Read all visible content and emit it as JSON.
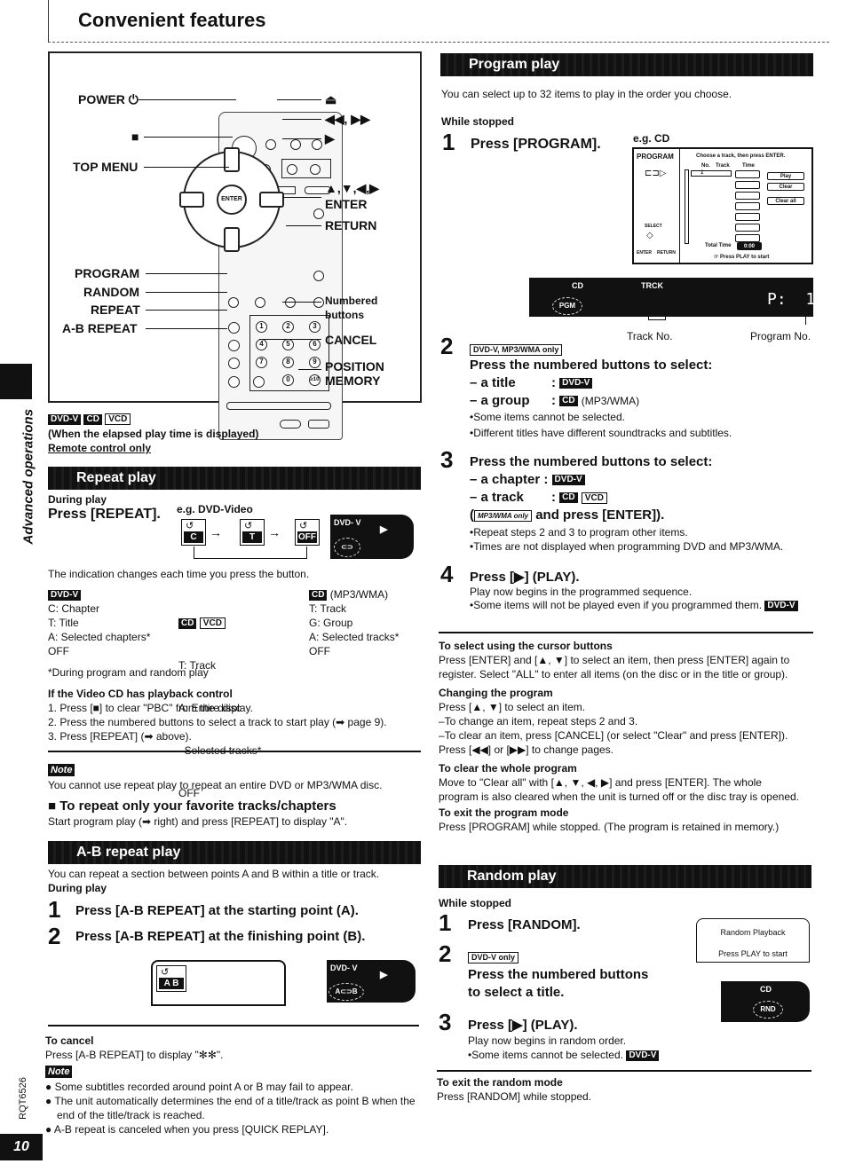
{
  "page": {
    "title": "Convenient features",
    "side_label": "Advanced operations",
    "page_number": "10",
    "doc_code": "RQT6526"
  },
  "remote": {
    "labels_left": [
      "POWER ⏻",
      "■",
      "TOP MENU",
      "PROGRAM",
      "RANDOM",
      "REPEAT",
      "A-B REPEAT"
    ],
    "labels_right": [
      "⏏",
      "◀◀, ▶▶",
      "▶",
      "▲,▼,◀,▶",
      "ENTER",
      "RETURN",
      "Numbered",
      "buttons",
      "CANCEL",
      "POSITION",
      "MEMORY"
    ],
    "numbers": [
      "1",
      "2",
      "3",
      "4",
      "5",
      "6",
      "7",
      "8",
      "9",
      "0",
      "≥10"
    ],
    "enter_label": "ENTER",
    "badges": [
      "DVD-V",
      "CD",
      "VCD"
    ],
    "condition": "(When the elapsed play time is displayed)",
    "remote_only": "Remote control only"
  },
  "repeat": {
    "heading": "Repeat play",
    "during": "During play",
    "instruction": "Press [REPEAT].",
    "example": "e.g. DVD-Video",
    "cycle": [
      "C",
      "T",
      "OFF"
    ],
    "lcd_label": "DVD- V",
    "indication": "The indication changes each time you press the button.",
    "columns": [
      {
        "badges": [
          "DVD-V"
        ],
        "suffix": "",
        "items": [
          "C: Chapter",
          "T: Title",
          "A: Selected chapters*",
          "OFF"
        ]
      },
      {
        "badges": [
          "CD",
          "VCD"
        ],
        "suffix": "",
        "items": [
          "T: Track",
          "A: Entire disc",
          "  Selected tracks*",
          "OFF"
        ]
      },
      {
        "badges": [
          "CD"
        ],
        "suffix": "(MP3/WMA)",
        "items": [
          "T: Track",
          "G: Group",
          "A: Selected tracks*",
          "OFF"
        ]
      }
    ],
    "footnote": "*During program and random play",
    "vcd_heading": "If the Video CD has playback control",
    "vcd_steps": [
      "1.  Press [■] to clear \"PBC\" from the display.",
      "2.  Press the numbered buttons to select a track to start play (➡ page 9).",
      "3.  Press [REPEAT] (➡ above)."
    ],
    "note_label": "Note",
    "note_text": "You cannot use repeat play to repeat an entire DVD or MP3/WMA disc.",
    "fav_heading": "■ To repeat only your favorite tracks/chapters",
    "fav_text": "Start program play (➡ right) and press [REPEAT] to display \"A\"."
  },
  "ab_repeat": {
    "heading": "A-B repeat play",
    "intro": "You can repeat a section between points A and B within a title or track.",
    "during": "During play",
    "steps": [
      {
        "num": "1",
        "text": "Press [A-B REPEAT] at the starting point (A)."
      },
      {
        "num": "2",
        "text": "Press [A-B REPEAT] at the finishing point (B)."
      }
    ],
    "osd_label": "A B",
    "lcd_label": "DVD- V",
    "lcd_indicator": "A⊂⊃B",
    "cancel_heading": "To cancel",
    "cancel_text": "Press [A-B REPEAT] to display \"✻✻\".",
    "note_label": "Note",
    "notes": [
      "Some subtitles recorded around point A or B may fail to appear.",
      "The unit automatically determines the end of a title/track as point B when the end of the title/track is reached.",
      "A-B repeat is canceled when you press [QUICK REPLAY]."
    ]
  },
  "program": {
    "heading": "Program play",
    "intro": "You can select up to 32 items to play in the order you choose.",
    "while_stopped": "While stopped",
    "step1": {
      "num": "1",
      "text": "Press [PROGRAM]."
    },
    "example": "e.g. CD",
    "osd": {
      "title": "PROGRAM",
      "instruction": "Choose a track, then press ENTER.",
      "col_no": "No.",
      "col_track": "Track",
      "col_time": "Time",
      "row_no": "1",
      "buttons": [
        "Play",
        "Clear",
        "Clear all"
      ],
      "select": "SELECT",
      "enter": "ENTER",
      "return": "RETURN",
      "total_time": "Total Time",
      "total_value": "0:00",
      "hint": "☞ Press PLAY to start"
    },
    "lcd": {
      "disc": "CD",
      "track": "TRCK",
      "pgm": "PGM",
      "display": "P:  1"
    },
    "track_no": "Track No.",
    "program_no": "Program No.",
    "step2": {
      "num": "2",
      "badge": "DVD-V, MP3/WMA only",
      "text": "Press the numbered buttons to select:",
      "options": [
        {
          "label": "– a title",
          "badge": "DVD-V",
          "suffix": ""
        },
        {
          "label": "– a group",
          "badge": "CD",
          "suffix": "(MP3/WMA)"
        }
      ],
      "bullets": [
        "•Some items cannot be selected.",
        "•Different titles have different soundtracks and subtitles."
      ]
    },
    "step3": {
      "num": "3",
      "text": "Press the numbered buttons to select:",
      "chapter": "– a chapter :",
      "chapter_badge": "DVD-V",
      "track": "– a track",
      "track_badges": [
        "CD",
        "VCD"
      ],
      "mp3_badge": "MP3/WMA only",
      "mp3_text": "and press [ENTER]).",
      "bullets": [
        "•Repeat steps 2 and 3 to program other items.",
        "•Times are not displayed when programming DVD and MP3/WMA."
      ]
    },
    "step4": {
      "num": "4",
      "text": "Press [▶] (PLAY).",
      "desc": "Play now begins in the programmed sequence.",
      "bullet": "•Some items will not be played even if you programmed them.",
      "badge": "DVD-V"
    },
    "tips": [
      {
        "heading": "To select using the cursor buttons",
        "lines": [
          "Press [ENTER] and [▲, ▼] to select an item, then press [ENTER] again to",
          "register. Select \"ALL\" to enter all items (on the disc or in the title or group)."
        ]
      },
      {
        "heading": "Changing the program",
        "lines": [
          "Press [▲, ▼] to select an item.",
          "–To change an item, repeat steps 2 and 3.",
          "–To clear an item, press [CANCEL] (or select \"Clear\" and press [ENTER]).",
          "Press [◀◀] or [▶▶] to change pages."
        ]
      },
      {
        "heading": "To clear the whole program",
        "lines": [
          "Move to \"Clear all\" with [▲, ▼, ◀, ▶] and press [ENTER]. The whole",
          "program is also cleared when the unit is turned off or the disc tray is opened."
        ]
      },
      {
        "heading": "To exit the program mode",
        "lines": [
          "Press [PROGRAM] while stopped. (The program is retained in memory.)"
        ]
      }
    ]
  },
  "random": {
    "heading": "Random play",
    "while_stopped": "While stopped",
    "step1": {
      "num": "1",
      "text": "Press [RANDOM]."
    },
    "step2": {
      "num": "2",
      "badge": "DVD-V only",
      "text1": "Press the numbered buttons",
      "text2": "to select a title."
    },
    "step3": {
      "num": "3",
      "text": "Press [▶] (PLAY).",
      "desc": "Play now begins in random order.",
      "bullet": "•Some items cannot be selected.",
      "badge": "DVD-V"
    },
    "osd_line1": "Random Playback",
    "osd_line2": "Press PLAY to start",
    "lcd_disc": "CD",
    "lcd_indicator": "RND",
    "exit_heading": "To exit the random mode",
    "exit_text": "Press [RANDOM] while stopped."
  }
}
